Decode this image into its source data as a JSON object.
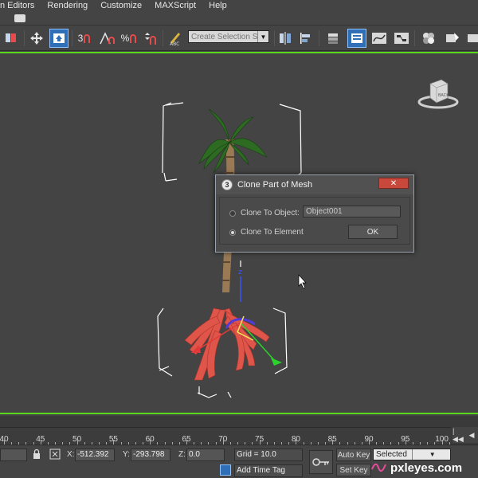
{
  "menu": {
    "items": [
      "n Editors",
      "Rendering",
      "Customize",
      "MAXScript",
      "Help"
    ]
  },
  "toolbar": {
    "selection_set_placeholder": "Create Selection Se",
    "snap_labels": [
      "3",
      "%"
    ],
    "icons": [
      "select-link-icon",
      "move-icon",
      "select-highlight-icon",
      "snap-3d-icon",
      "angle-snap-icon",
      "percent-snap-icon",
      "spinner-snap-icon",
      "edit-named-selection-icon",
      "mirror-icon",
      "align-icon",
      "layer-icon",
      "scene-explorer-icon",
      "curve-editor-icon",
      "schematic-view-icon",
      "material-editor-icon",
      "render-setup-icon",
      "render-icon"
    ]
  },
  "dialog": {
    "title": "Clone Part of Mesh",
    "close_symbol": "✕",
    "option_object": "Clone To Object:",
    "object_name": "Object001",
    "option_element": "Clone To Element",
    "selected_option": "element",
    "ok_label": "OK"
  },
  "viewport": {
    "active_border_color": "#59d81e",
    "axis_z_label": "z",
    "viewcube_label": "BACK"
  },
  "timeline": {
    "ticks": [
      40,
      45,
      50,
      55,
      60,
      65,
      70,
      75,
      80,
      85,
      90,
      95,
      100
    ]
  },
  "status": {
    "x_label": "X:",
    "x_value": "-512.392",
    "y_label": "Y:",
    "y_value": "-293.798",
    "z_label": "Z:",
    "z_value": "0.0",
    "grid": "Grid = 10.0",
    "add_time_tag": "Add Time Tag",
    "auto_key": "Auto Key",
    "set_key": "Set Key",
    "key_mode": "Selected"
  },
  "watermark": {
    "text": "pxleyes.com"
  }
}
